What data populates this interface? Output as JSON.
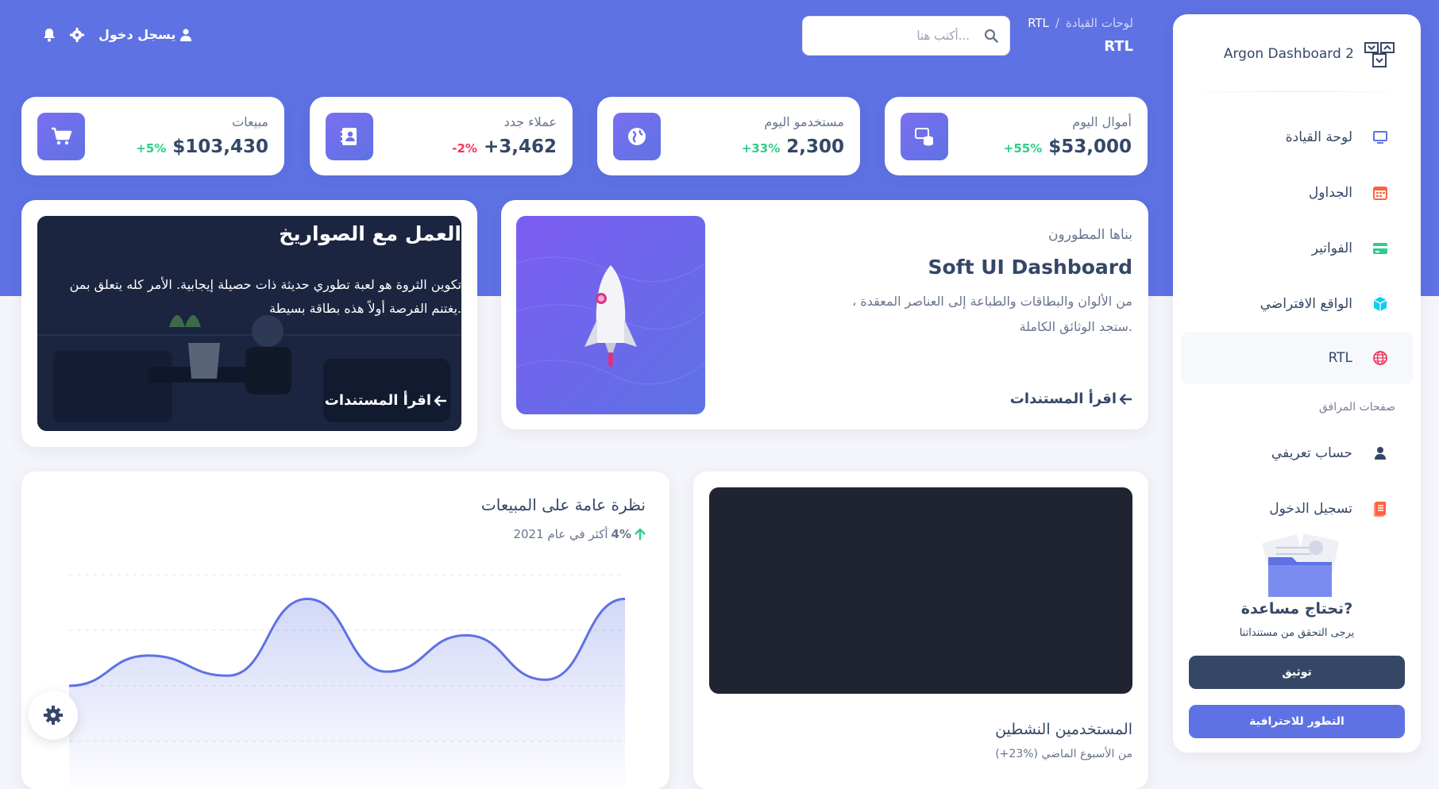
{
  "sidebar": {
    "brand": "Argon Dashboard 2",
    "items": [
      {
        "label": "لوحة القيادة",
        "icon": "tv-icon",
        "active": false
      },
      {
        "label": "الجداول",
        "icon": "calendar-grid-icon",
        "active": false
      },
      {
        "label": "الفواتير",
        "icon": "credit-card-icon",
        "active": false
      },
      {
        "label": "الواقع الافتراضي",
        "icon": "cube-icon",
        "active": false
      },
      {
        "label": "RTL",
        "icon": "world-icon",
        "active": true
      }
    ],
    "section_title": "صفحات المرافق",
    "section_items": [
      {
        "label": "حساب تعريفي",
        "icon": "user-icon"
      },
      {
        "label": "تسجيل الدخول",
        "icon": "document-icon"
      }
    ],
    "help_title": "تحتاج مساعدة?",
    "help_subtitle": "يرجى التحقق من مستنداتنا",
    "docs_button": "توثيق",
    "upgrade_button": "التطور للاحترافية"
  },
  "header": {
    "breadcrumb_parent": "لوحات القيادة",
    "breadcrumb_separator": "/",
    "breadcrumb_current": "RTL",
    "page_title": "RTL",
    "search_placeholder": "أكتب هنا...",
    "signin_label": "يسجل دخول"
  },
  "stats": [
    {
      "title": "أموال اليوم",
      "value": "$53,000",
      "change": "+55%",
      "change_color": "#2dce89",
      "icon": "database-icon"
    },
    {
      "title": "مستخدمو اليوم",
      "value": "2,300",
      "change": "+33%",
      "change_color": "#2dce89",
      "icon": "globe-icon"
    },
    {
      "title": "عملاء جدد",
      "value": "+3,462",
      "change": "-2%",
      "change_color": "#f5365c",
      "icon": "contacts-icon"
    },
    {
      "title": "مبيعات",
      "value": "$103,430",
      "change": "+5%",
      "change_color": "#2dce89",
      "icon": "cart-icon"
    }
  ],
  "soft_card": {
    "subtitle": "بناها المطورون",
    "title": "Soft UI Dashboard",
    "description": "من الألوان والبطاقات والطباعة إلى العناصر المعقدة ، ستجد الوثائق الكاملة.",
    "link": "اقرأ المستندات"
  },
  "rockets_card": {
    "title": "العمل مع الصواريخ",
    "description": "تكوين الثروة هو لعبة تطوري حديثة ذات حصيلة إيجابية. الأمر كله يتعلق بمن يغتنم الفرصة أولاً هذه بطاقة بسيطة.",
    "link": "اقرأ المستندات"
  },
  "active_users": {
    "title": "المستخدمين النشطين",
    "subtitle_change": "(+23%)",
    "subtitle_text": "من الأسبوع الماضي"
  },
  "sales": {
    "title": "نظرة عامة على المبيعات",
    "change": "4%",
    "change_text": "أكثر في عام 2021"
  },
  "chart_data": {
    "type": "line",
    "values": [
      55,
      70,
      60,
      98,
      62,
      80,
      58,
      98
    ],
    "title": "",
    "ylim": [
      0,
      110
    ]
  },
  "colors": {
    "primary": "#5e72e4",
    "success": "#2dce89",
    "danger": "#f5365c",
    "dark": "#344767"
  }
}
